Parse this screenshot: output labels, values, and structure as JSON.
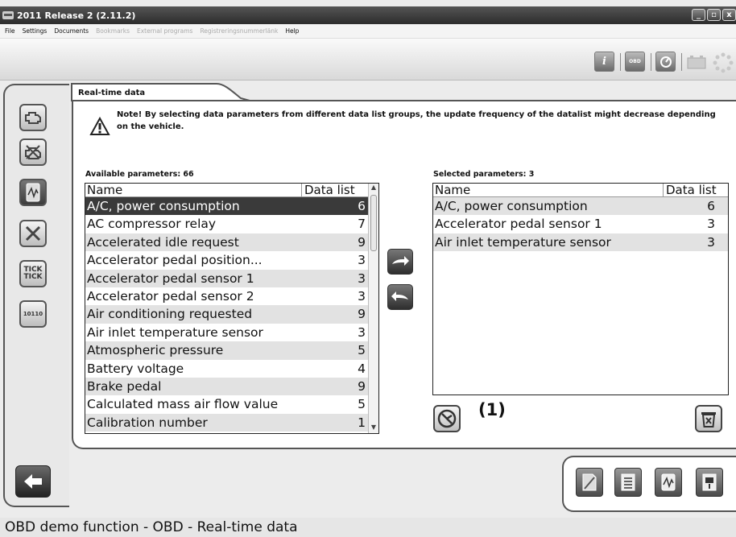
{
  "window": {
    "title": "2011 Release 2 (2.11.2)",
    "buttons": [
      "_",
      "▫",
      "x"
    ]
  },
  "menu": {
    "items": [
      {
        "label": "File",
        "enabled": true
      },
      {
        "label": "Settings",
        "enabled": true
      },
      {
        "label": "Documents",
        "enabled": true
      },
      {
        "label": "Bookmarks",
        "enabled": false
      },
      {
        "label": "External programs",
        "enabled": false
      },
      {
        "label": "Registreringsnummerlänk",
        "enabled": false
      },
      {
        "label": "Help",
        "enabled": true
      }
    ]
  },
  "toolbar": {
    "info_label": "i",
    "obd_label": "OBD"
  },
  "sidebar": {
    "icons": [
      "engine-icon",
      "engine-off-icon",
      "realtime-data-icon",
      "tools-icon",
      "tick-tick-icon",
      "binary-data-icon"
    ],
    "tick_label": "TICK TICK",
    "binary_label": "10110"
  },
  "main": {
    "tab_title": "Real-time data",
    "note": "Note! By selecting data parameters from different data list groups, the update frequency of the datalist might decrease depending on the vehicle.",
    "available_label": "Available parameters: 66",
    "selected_label": "Selected parameters: 3",
    "columns": {
      "name": "Name",
      "data_list": "Data list"
    },
    "available": [
      {
        "name": "A/C, power consumption",
        "list": "6"
      },
      {
        "name": "AC compressor relay",
        "list": "7"
      },
      {
        "name": "Accelerated idle request",
        "list": "9"
      },
      {
        "name": "Accelerator  pedal  position...",
        "list": "3"
      },
      {
        "name": "Accelerator pedal sensor 1",
        "list": "3"
      },
      {
        "name": "Accelerator pedal sensor 2",
        "list": "3"
      },
      {
        "name": "Air conditioning requested",
        "list": "9"
      },
      {
        "name": "Air inlet temperature sensor",
        "list": "3"
      },
      {
        "name": "Atmospheric pressure",
        "list": "5"
      },
      {
        "name": "Battery voltage",
        "list": "4"
      },
      {
        "name": "Brake pedal",
        "list": "9"
      },
      {
        "name": "Calculated mass air flow value",
        "list": "5"
      },
      {
        "name": "Calibration number",
        "list": "1"
      }
    ],
    "selected": [
      {
        "name": "A/C, power consumption",
        "list": "6"
      },
      {
        "name": "Accelerator pedal sensor 1",
        "list": "3"
      },
      {
        "name": "Air inlet temperature sensor",
        "list": "3"
      }
    ],
    "callout": "(1)"
  },
  "status": "OBD demo function - OBD - Real-time data",
  "colors": {
    "selection": "#3a3a3a",
    "alt_row": "#e2e2e2",
    "title_bar": "#2c2c2c"
  }
}
